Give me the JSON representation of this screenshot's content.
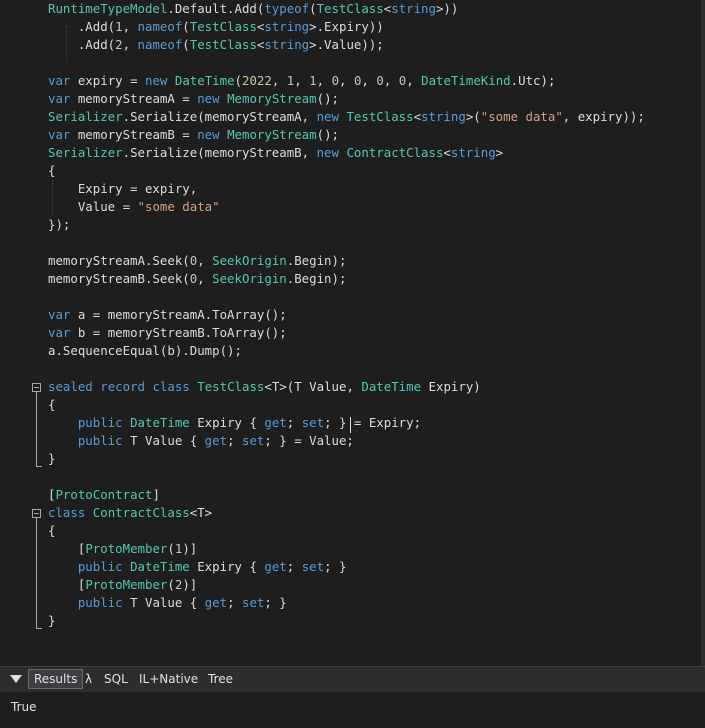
{
  "code": {
    "l1": {
      "a": "RuntimeTypeModel",
      "b": ".Default.Add(",
      "c": "typeof",
      "d": "(",
      "e": "TestClass",
      "f": "<",
      "g": "string",
      "h": ">))"
    },
    "l2": {
      "a": "    .Add(",
      "b": "1",
      ", ": "",
      "c": ", ",
      "d": "nameof",
      "e": "(",
      "f": "TestClass",
      "g": "<",
      "h": "string",
      "i": ">.Expiry))"
    },
    "l3": {
      "a": "    .Add(",
      "b": "2",
      "c": ", ",
      "d": "nameof",
      "e": "(",
      "f": "TestClass",
      "g": "<",
      "h": "string",
      "i": ">.Value));"
    },
    "l5": {
      "a": "var",
      "b": " expiry = ",
      "c": "new",
      "d": " ",
      "e": "DateTime",
      "f": "(",
      "g": "2022",
      ", ": "",
      "h": ", ",
      "i": "1",
      "j": ", ",
      "k": "1",
      "l": ", ",
      "m": "0",
      "n": ", ",
      "o": "0",
      "p": ", ",
      "q": "0",
      "r": ", ",
      "s": "0",
      "t": ", ",
      "u": "DateTimeKind",
      "v": ".Utc);"
    },
    "l6": {
      "a": "var",
      "b": " memoryStreamA = ",
      "c": "new",
      "d": " ",
      "e": "MemoryStream",
      "f": "();"
    },
    "l7": {
      "a": "Serializer",
      "b": ".Serialize(memoryStreamA, ",
      "c": "new",
      "d": " ",
      "e": "TestClass",
      "f": "<",
      "g": "string",
      "h": ">(",
      "i": "\"some data\"",
      "j": ", expiry));"
    },
    "l8": {
      "a": "var",
      "b": " memoryStreamB = ",
      "c": "new",
      "d": " ",
      "e": "MemoryStream",
      "f": "();"
    },
    "l9": {
      "a": "Serializer",
      "b": ".Serialize(memoryStreamB, ",
      "c": "new",
      "d": " ",
      "e": "ContractClass",
      "f": "<",
      "g": "string",
      "h": ">"
    },
    "l10": "{",
    "l11": "    Expiry = expiry,",
    "l12": {
      "a": "    Value = ",
      "b": "\"some data\""
    },
    "l13": "});",
    "l15": {
      "a": "memoryStreamA.Seek(",
      "b": "0",
      "c": ", ",
      "d": "SeekOrigin",
      "e": ".Begin);"
    },
    "l16": {
      "a": "memoryStreamB.Seek(",
      "b": "0",
      "c": ", ",
      "d": "SeekOrigin",
      "e": ".Begin);"
    },
    "l18": {
      "a": "var",
      "b": " a = memoryStreamA.ToArray();"
    },
    "l19": {
      "a": "var",
      "b": " b = memoryStreamB.ToArray();"
    },
    "l20": "a.SequenceEqual(b).Dump();",
    "l22": {
      "a": "sealed",
      "b": " ",
      "c": "record",
      "d": " ",
      "e": "class",
      "f": " ",
      "g": "TestClass",
      "h": "<T>(T Value, ",
      "i": "DateTime",
      "j": " Expiry)"
    },
    "l23": "{",
    "l24": {
      "a": "    ",
      "b": "public",
      "c": " ",
      "d": "DateTime",
      "e": " Expiry { ",
      "f": "get",
      "g": "; ",
      "h": "set",
      "i": "; } = Expiry;"
    },
    "l25": {
      "a": "    ",
      "b": "public",
      "c": " T Value { ",
      "d": "get",
      "e": "; ",
      "f": "set",
      "g": "; } = Value;"
    },
    "l26": "}",
    "l28": {
      "a": "[",
      "b": "ProtoContract",
      "c": "]"
    },
    "l29": {
      "a": "class",
      "b": " ",
      "c": "ContractClass",
      "d": "<T>"
    },
    "l30": "{",
    "l31": {
      "a": "    [",
      "b": "ProtoMember",
      "c": "(",
      "d": "1",
      "e": ")]"
    },
    "l32": {
      "a": "    ",
      "b": "public",
      "c": " ",
      "d": "DateTime",
      "e": " Expiry { ",
      "f": "get",
      "g": "; ",
      "h": "set",
      "i": "; }"
    },
    "l33": {
      "a": "    [",
      "b": "ProtoMember",
      "c": "(",
      "d": "2",
      "e": ")]"
    },
    "l34": {
      "a": "    ",
      "b": "public",
      "c": " T Value { ",
      "d": "get",
      "e": "; ",
      "f": "set",
      "g": "; }"
    },
    "l35": "}"
  },
  "tabs": {
    "results": "Results",
    "lambda": "λ",
    "sql": "SQL",
    "il": "IL+Native",
    "tree": "Tree"
  },
  "output": {
    "value": "True"
  },
  "colors": {
    "background": "#1e1e1e",
    "keyword": "#569cd6",
    "type": "#4ec9b0",
    "string": "#d69d85",
    "number": "#b5cea8",
    "plain": "#dcdcdc"
  }
}
